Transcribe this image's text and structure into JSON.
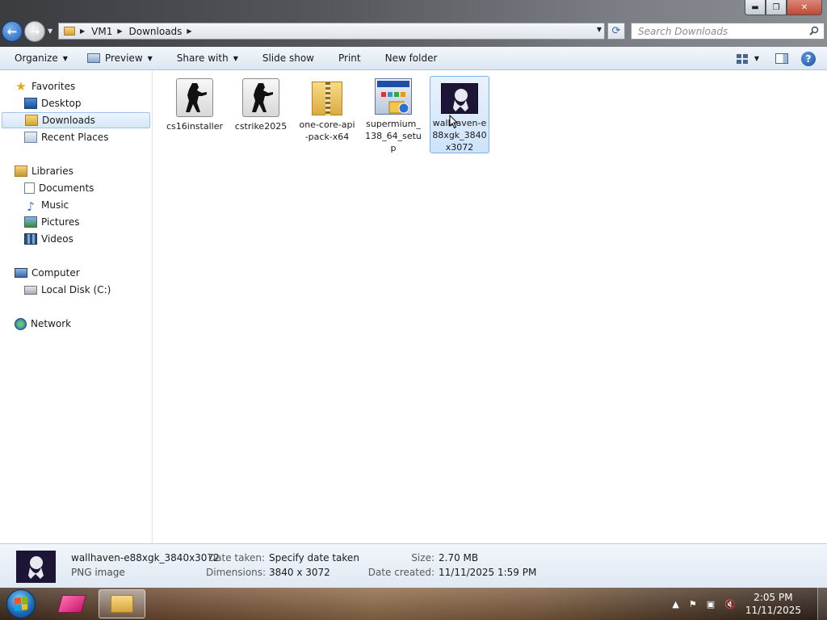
{
  "address": {
    "crumbs": [
      "VM1",
      "Downloads"
    ]
  },
  "search": {
    "placeholder": "Search Downloads"
  },
  "toolbar": {
    "organize": "Organize",
    "preview": "Preview",
    "share_with": "Share with",
    "slide_show": "Slide show",
    "print": "Print",
    "new_folder": "New folder"
  },
  "nav": {
    "favorites": "Favorites",
    "desktop": "Desktop",
    "downloads": "Downloads",
    "recent_places": "Recent Places",
    "libraries": "Libraries",
    "documents": "Documents",
    "music": "Music",
    "pictures": "Pictures",
    "videos": "Videos",
    "computer": "Computer",
    "local_disk": "Local Disk (C:)",
    "network": "Network"
  },
  "files": [
    {
      "name": "cs16installer",
      "icon": "counter-strike-icon"
    },
    {
      "name": "cstrike2025",
      "icon": "counter-strike-icon"
    },
    {
      "name": "one-core-api-pack-x64",
      "icon": "zip-folder-icon"
    },
    {
      "name": "supermium_138_64_setup",
      "icon": "installer-icon"
    },
    {
      "name": "wallhaven-e88xgk_3840x3072",
      "icon": "image-thumbnail-icon"
    }
  ],
  "details": {
    "name": "wallhaven-e88xgk_3840x3072",
    "type": "PNG image",
    "date_taken_label": "Date taken:",
    "date_taken_value": "Specify date taken",
    "dimensions_label": "Dimensions:",
    "dimensions_value": "3840 x 3072",
    "size_label": "Size:",
    "size_value": "2.70 MB",
    "date_created_label": "Date created:",
    "date_created_value": "11/11/2025 1:59 PM"
  },
  "taskbar": {
    "time": "2:05 PM",
    "date": "11/11/2025"
  }
}
